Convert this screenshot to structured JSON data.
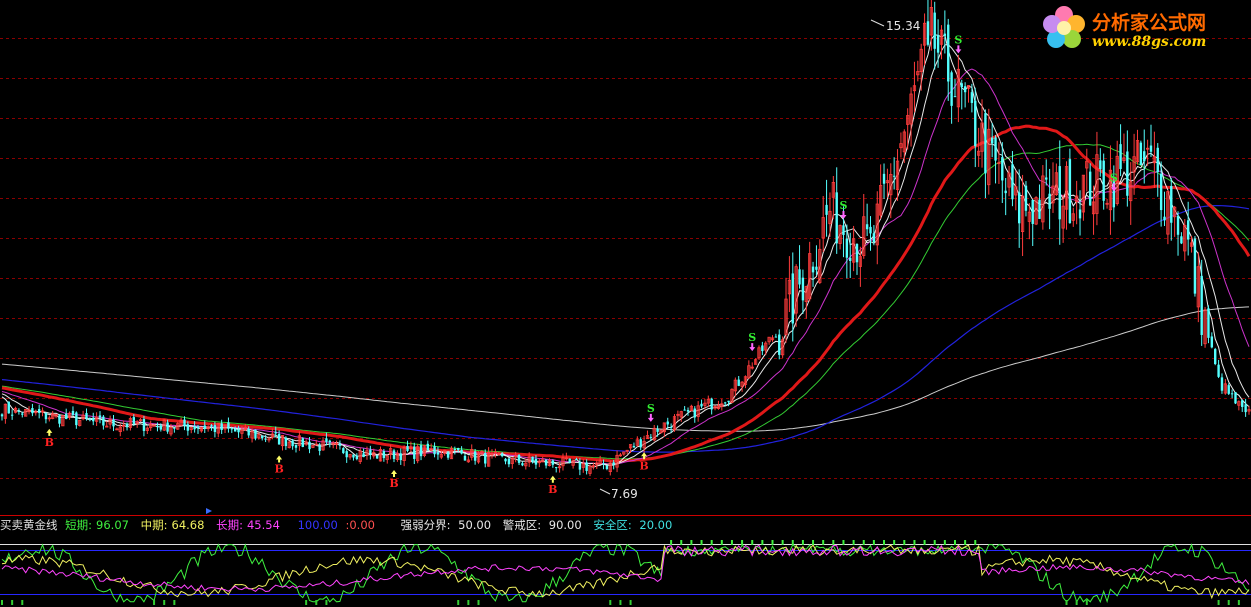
{
  "logo": {
    "title": "分析家公式网",
    "url": "www.88gs.com"
  },
  "indicator": {
    "name": "买卖黄金线",
    "short_label": "短期:",
    "short_value": "96.07",
    "mid_label": "中期:",
    "mid_value": "64.68",
    "long_label": "长期:",
    "long_value": "45.54",
    "level_a": "100.00",
    "level_b": "0.00",
    "strong_weak_label": "强弱分界:",
    "strong_weak_value": "50.00",
    "warn_label": "警戒区:",
    "warn_value": "90.00",
    "safe_label": "安全区:",
    "safe_value": "20.00"
  },
  "colors": {
    "up_candle": "#ff3c3c",
    "down_candle": "#54ffff",
    "ma_thick": "#e01818",
    "ma_white": "#e8e8e8",
    "ma_magenta": "#cc33cc",
    "ma_green": "#33cc33",
    "ma_blue": "#2222dd",
    "ma_long": "#cccccc",
    "grid": "#8a0000",
    "separator": "#cc0000"
  },
  "chart_data": [
    {
      "type": "candlestick",
      "title": "",
      "high_label": "15.34",
      "low_label": "7.69",
      "anchors": [
        {
          "i": 0,
          "p": 8.7
        },
        {
          "i": 30,
          "p": 8.45
        },
        {
          "i": 60,
          "p": 8.4
        },
        {
          "i": 90,
          "p": 8.1
        },
        {
          "i": 110,
          "p": 7.9
        },
        {
          "i": 130,
          "p": 7.98
        },
        {
          "i": 150,
          "p": 7.8
        },
        {
          "i": 178,
          "p": 7.69
        },
        {
          "i": 195,
          "p": 8.4
        },
        {
          "i": 215,
          "p": 8.95
        },
        {
          "i": 232,
          "p": 10.3
        },
        {
          "i": 245,
          "p": 12.2
        },
        {
          "i": 257,
          "p": 11.5
        },
        {
          "i": 270,
          "p": 14.2
        },
        {
          "i": 274,
          "p": 15.34
        },
        {
          "i": 290,
          "p": 13.4
        },
        {
          "i": 300,
          "p": 12.2
        },
        {
          "i": 320,
          "p": 12.6
        },
        {
          "i": 340,
          "p": 13.0
        },
        {
          "i": 350,
          "p": 11.8
        },
        {
          "i": 360,
          "p": 9.2
        },
        {
          "i": 368,
          "p": 8.6
        }
      ],
      "buy_signals": [
        {
          "i": 14,
          "label": "B"
        },
        {
          "i": 82,
          "label": "B"
        },
        {
          "i": 116,
          "label": "B"
        },
        {
          "i": 163,
          "label": "B"
        },
        {
          "i": 190,
          "label": "B"
        }
      ],
      "sell_signals": [
        {
          "i": 222,
          "label": "S"
        },
        {
          "i": 192,
          "label": "S"
        },
        {
          "i": 249,
          "label": "S"
        },
        {
          "i": 283,
          "label": "S"
        },
        {
          "i": 329,
          "label": "S"
        }
      ],
      "y_range": [
        7.2,
        15.5
      ]
    },
    {
      "type": "line",
      "title": "买卖黄金线",
      "series_names": [
        "短期",
        "中期",
        "长期"
      ],
      "last_values": [
        96.07,
        64.68,
        45.54
      ],
      "levels": [
        100,
        0,
        50,
        90,
        20
      ],
      "y_range": [
        0,
        100
      ]
    }
  ]
}
